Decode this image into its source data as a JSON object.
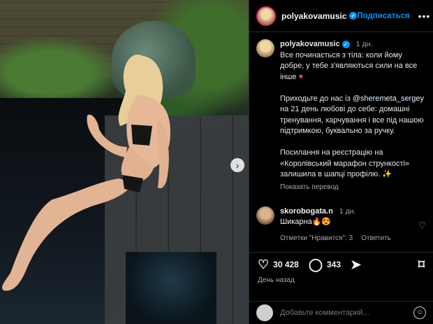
{
  "post": {
    "username": "polyakovamusic",
    "follow_label": "Подписаться",
    "more_label": "•••"
  },
  "caption": {
    "username": "polyakovamusic",
    "time": "1 дн.",
    "p1": "Все починається з тіла: коли йому добре, у тебе з'являються сили на все інше",
    "p1_emoji": "♥",
    "p2_a": "Приходьте до нас із ",
    "p2_mention": "@sheremeta_sergey",
    "p2_b": " на 21 день любові до себе: домашні тренування, харчування і все під нашою підтримкою, буквально за ручку.",
    "p3": "Посилання на реєстрацію на «Королівський марафон стрункості» залишила в шапці профілю. ✨",
    "translate_label": "Показать перевод"
  },
  "comment": {
    "username": "skorobogata.n",
    "time": "1 дн.",
    "text": "Шикарна🔥😍",
    "likes_label": "Отметки \"Нравится\": 3",
    "reply_label": "Ответить"
  },
  "actions": {
    "likes": "30 428",
    "comments": "343",
    "date": "День назад"
  },
  "input": {
    "placeholder": "Добавьте комментарий..."
  }
}
